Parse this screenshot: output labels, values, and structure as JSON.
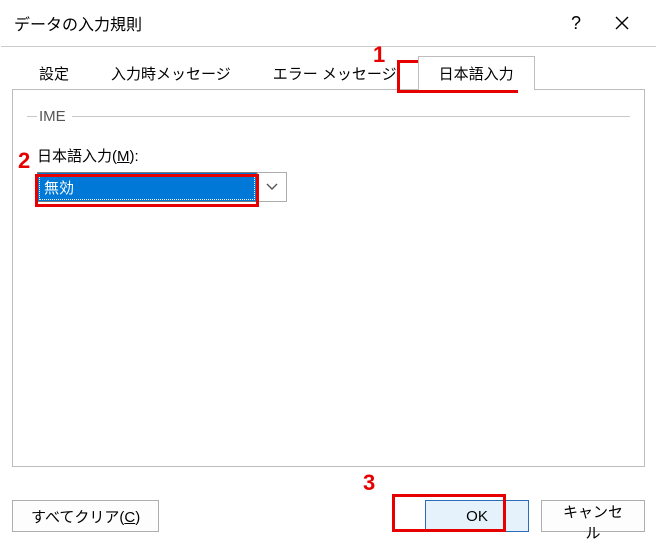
{
  "title": "データの入力規則",
  "tabs": {
    "settings": "設定",
    "input_msg": "入力時メッセージ",
    "error_msg": "エラー メッセージ",
    "ime": "日本語入力"
  },
  "ime_group": "IME",
  "field": {
    "label_prefix": "日本語入力(",
    "label_key": "M",
    "label_suffix": "):",
    "value": "無効"
  },
  "buttons": {
    "clear_prefix": "すべてクリア(",
    "clear_key": "C",
    "clear_suffix": ")",
    "ok": "OK",
    "cancel": "キャンセル"
  },
  "callouts": {
    "n1": "1",
    "n2": "2",
    "n3": "3"
  }
}
